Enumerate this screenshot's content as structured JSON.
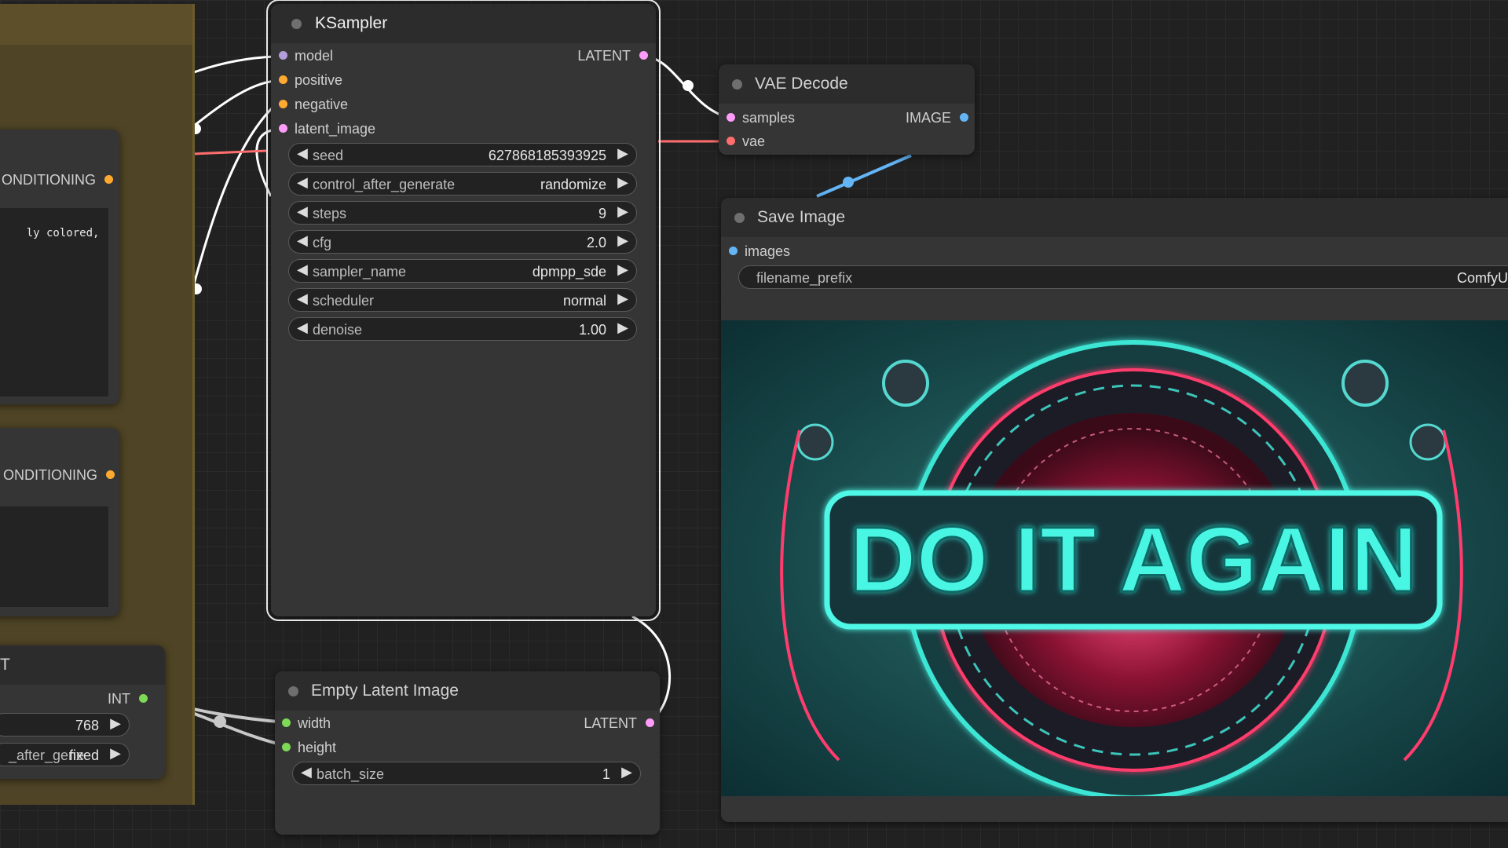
{
  "colors": {
    "model": "#b39ddb",
    "conditioning": "#ffa931",
    "latent": "#ff9cf9",
    "vae": "#ff6e6e",
    "image": "#64b5f6",
    "int": "#7ed957",
    "group": "#4f4425",
    "canvas": "#212121"
  },
  "left_nodes": {
    "cond_top_label": "ONDITIONING",
    "prompt_snippet": "ly colored,",
    "cond_bottom_label": "ONDITIONING",
    "int_node_title": "T",
    "int_output": "INT",
    "value_widget_value": "768",
    "control_widget_name": "_after_gene",
    "control_widget_value": "fixed"
  },
  "ksampler": {
    "title": "KSampler",
    "inputs": [
      "model",
      "positive",
      "negative",
      "latent_image"
    ],
    "output": "LATENT",
    "widgets": [
      {
        "name": "seed",
        "value": "627868185393925"
      },
      {
        "name": "control_after_generate",
        "value": "randomize"
      },
      {
        "name": "steps",
        "value": "9"
      },
      {
        "name": "cfg",
        "value": "2.0"
      },
      {
        "name": "sampler_name",
        "value": "dpmpp_sde"
      },
      {
        "name": "scheduler",
        "value": "normal"
      },
      {
        "name": "denoise",
        "value": "1.00"
      }
    ]
  },
  "vae_decode": {
    "title": "VAE Decode",
    "inputs": [
      "samples",
      "vae"
    ],
    "output": "IMAGE"
  },
  "save_image": {
    "title": "Save Image",
    "input": "images",
    "widget_name": "filename_prefix",
    "widget_value": "ComfyU",
    "preview_text": "DO IT AGAIN"
  },
  "empty_latent": {
    "title": "Empty Latent Image",
    "inputs": [
      "width",
      "height"
    ],
    "output": "LATENT",
    "widget_name": "batch_size",
    "widget_value": "1"
  }
}
